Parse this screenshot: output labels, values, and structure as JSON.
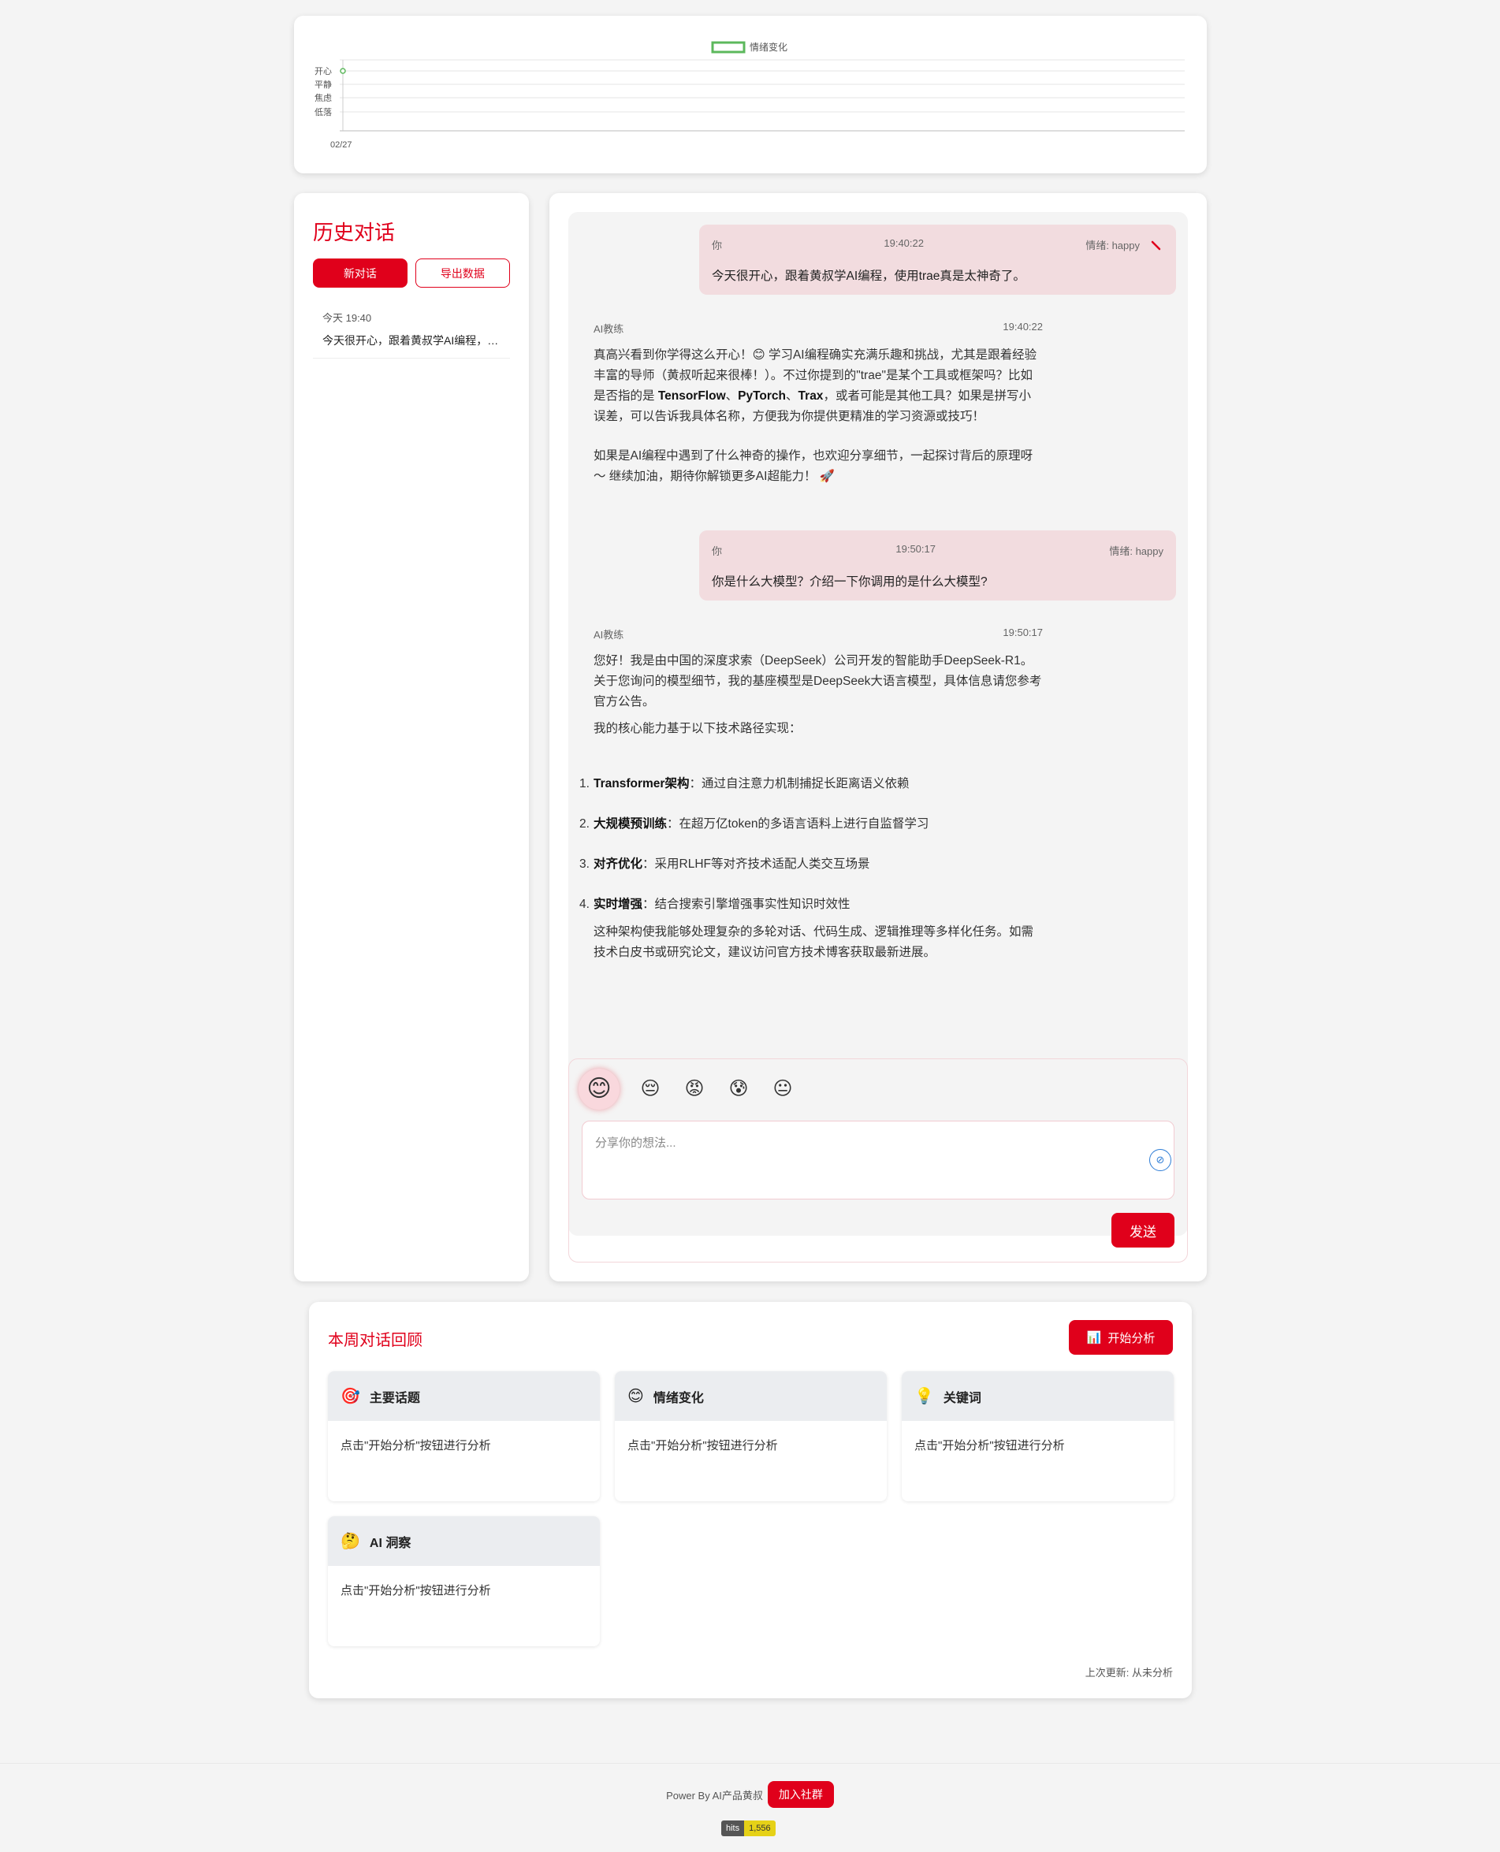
{
  "mood_chart": {
    "legend": "情绪变化",
    "y_labels": [
      "开心",
      "平静",
      "焦虑",
      "低落"
    ],
    "x_labels": [
      "02/27"
    ],
    "colors": {
      "line": "#5cb85c"
    }
  },
  "chart_data": {
    "type": "line",
    "categories": [
      "02/27"
    ],
    "series": [
      {
        "name": "情绪变化",
        "values": [
          "开心"
        ]
      }
    ],
    "y_categories": [
      "开心",
      "平静",
      "焦虑",
      "低落"
    ]
  },
  "history": {
    "title": "历史对话",
    "new_chat": "新对话",
    "export": "导出数据",
    "items": [
      {
        "time": "今天 19:40",
        "preview": "今天很开心，跟着黄叔学AI编程，使用trae真是太神奇了。"
      }
    ]
  },
  "messages": [
    {
      "role": "user",
      "who": "你",
      "time": "19:40:22",
      "mood": "情绪: happy",
      "text": "今天很开心，跟着黄叔学AI编程，使用trae真是太神奇了。"
    },
    {
      "role": "ai",
      "who": "AI教练",
      "time": "19:40:22",
      "p1": "真高兴看到你学得这么开心！😊 学习AI编程确实充满乐趣和挑战，尤其是跟着经验丰富的导师（黄叔听起来很棒！）。不过你提到的\"trae\"是某个工具或框架吗？比如是否指的是 ",
      "b1": "TensorFlow",
      "s1": "、",
      "b2": "PyTorch",
      "s2": "、",
      "b3": "Trax",
      "p1b": "，或者可能是其他工具？如果是拼写小误差，可以告诉我具体名称，方便我为你提供更精准的学习资源或技巧！",
      "p2": "如果是AI编程中遇到了什么神奇的操作，也欢迎分享细节，一起探讨背后的原理呀～ 继续加油，期待你解锁更多AI超能力！ 🚀"
    },
    {
      "role": "user",
      "who": "你",
      "time": "19:50:17",
      "mood": "情绪: happy",
      "text": "你是什么大模型？介绍一下你调用的是什么大模型?"
    },
    {
      "role": "ai",
      "who": "AI教练",
      "time": "19:50:17",
      "p1": "您好！我是由中国的深度求索（DeepSeek）公司开发的智能助手DeepSeek-R1。关于您询问的模型细节，我的基座模型是DeepSeek大语言模型，具体信息请您参考官方公告。",
      "p2": "我的核心能力基于以下技术路径实现：",
      "list": [
        {
          "num": "1.",
          "title": "Transformer架构",
          "desc": "：通过自注意力机制捕捉长距离语义依赖"
        },
        {
          "num": "2.",
          "title": "大规模预训练",
          "desc": "：在超万亿token的多语言语料上进行自监督学习"
        },
        {
          "num": "3.",
          "title": "对齐优化",
          "desc": "：采用RLHF等对齐技术适配人类交互场景"
        },
        {
          "num": "4.",
          "title": "实时增强",
          "desc": "：结合搜索引擎增强事实性知识时效性"
        }
      ],
      "p3": "这种架构使我能够处理复杂的多轮对话、代码生成、逻辑推理等多样化任务。如需技术白皮书或研究论文，建议访问官方技术博客获取最新进展。"
    }
  ],
  "input": {
    "moods": [
      "😊",
      "😔",
      "😡",
      "😰",
      "😐"
    ],
    "mood_names": [
      "happy-emoji",
      "sad-emoji",
      "angry-emoji",
      "anxious-emoji",
      "neutral-emoji"
    ],
    "placeholder": "分享你的想法...",
    "send": "发送"
  },
  "review": {
    "title": "本周对话回顾",
    "analyze": "开始分析",
    "analyze_icon": "📊",
    "cards": [
      {
        "icon": "🎯",
        "title": "主要话题",
        "body": "点击\"开始分析\"按钮进行分析"
      },
      {
        "icon": "😊",
        "title": "情绪变化",
        "body": "点击\"开始分析\"按钮进行分析"
      },
      {
        "icon": "💡",
        "title": "关键词",
        "body": "点击\"开始分析\"按钮进行分析"
      },
      {
        "icon": "🤔",
        "title": "AI 洞察",
        "body": "点击\"开始分析\"按钮进行分析"
      }
    ],
    "last_update": "上次更新: 从未分析"
  },
  "footer": {
    "power": "Power By AI产品黄叔",
    "join": "加入社群",
    "hits_label": "hits",
    "hits_value": "1,556"
  }
}
